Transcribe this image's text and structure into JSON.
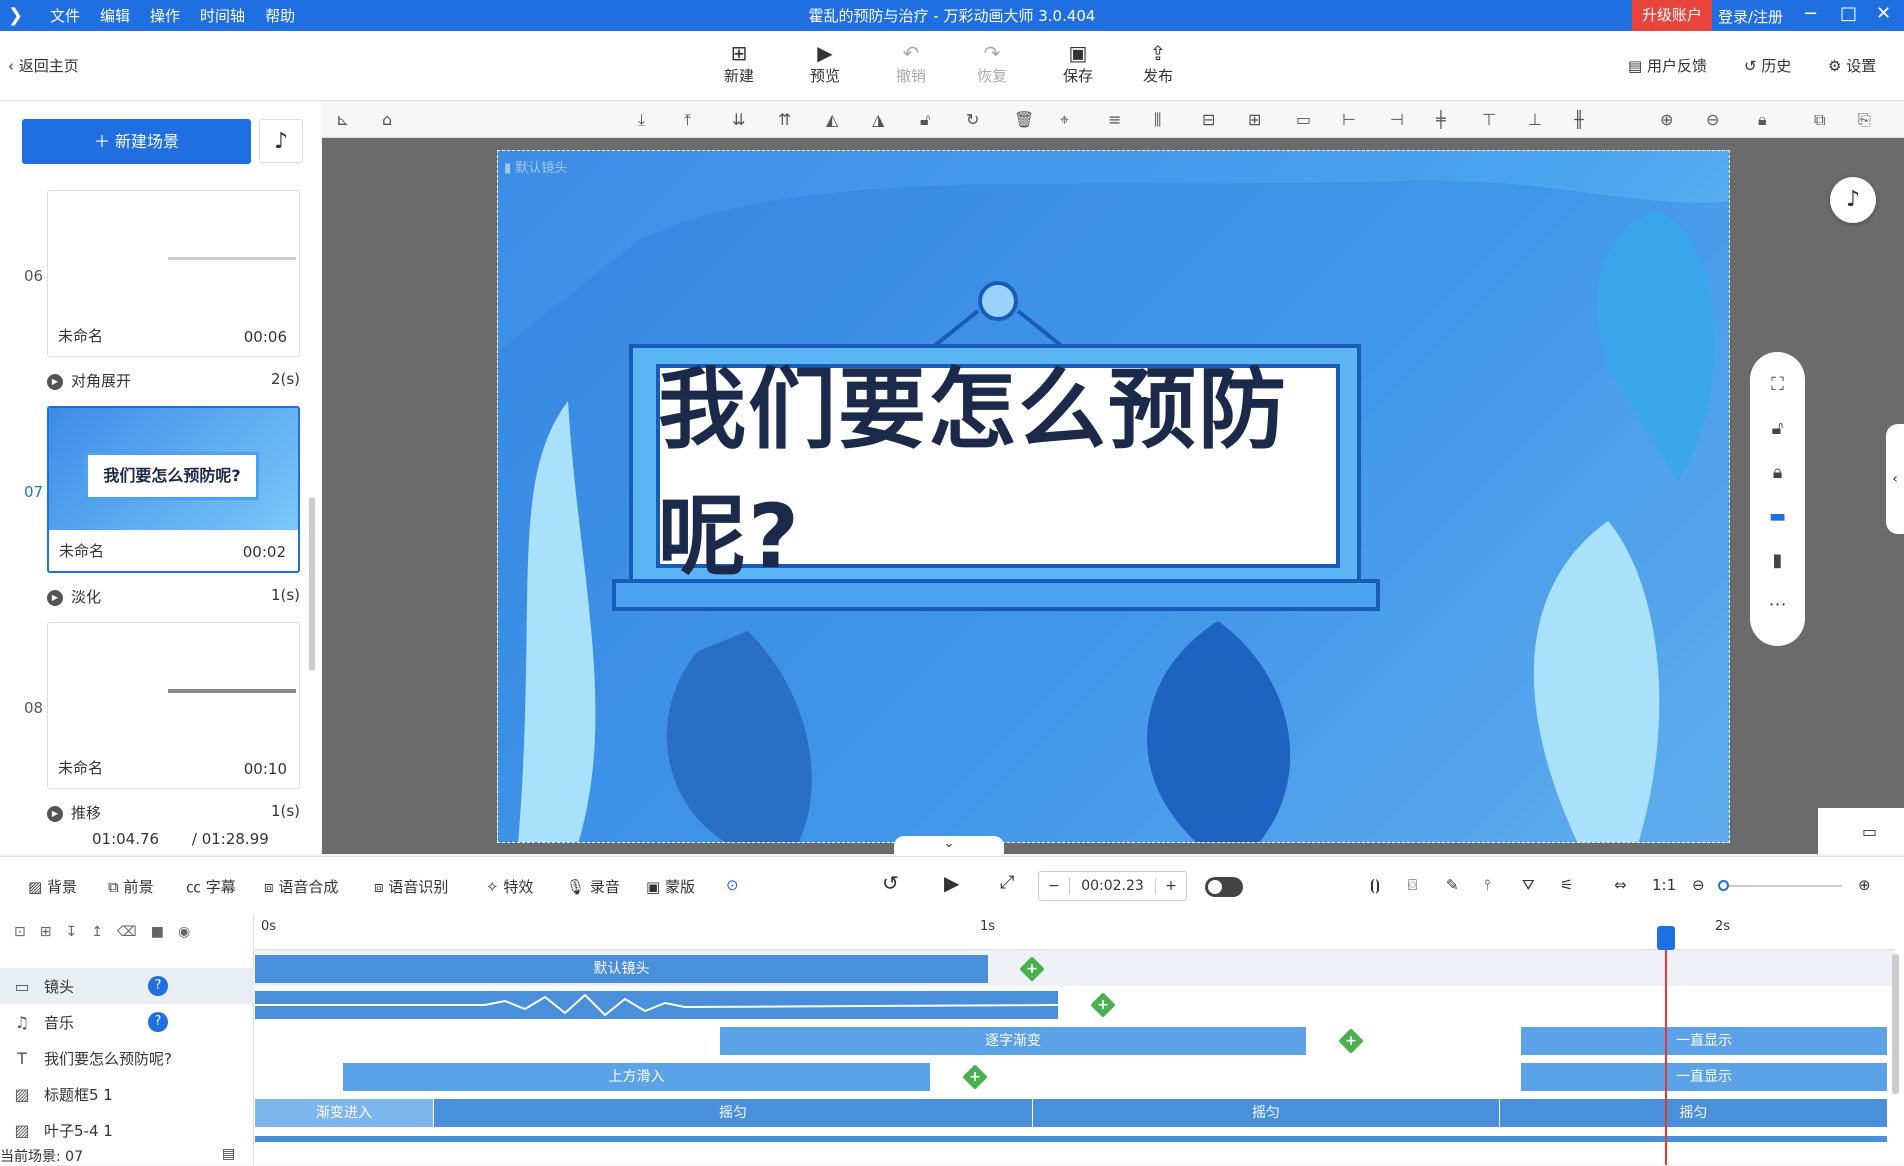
{
  "app": {
    "title": "霍乱的预防与治疗 - 万彩动画大师 3.0.404",
    "menu": [
      "文件",
      "编辑",
      "操作",
      "时间轴",
      "帮助"
    ],
    "upgrade": "升级账户",
    "login": "登录/注册"
  },
  "toolbar": {
    "back": "返回主页",
    "buttons": [
      {
        "label": "新建",
        "icon": "plus-square-icon",
        "disabled": false
      },
      {
        "label": "预览",
        "icon": "play-icon",
        "disabled": false
      },
      {
        "label": "撤销",
        "icon": "undo-icon",
        "disabled": true
      },
      {
        "label": "恢复",
        "icon": "redo-icon",
        "disabled": true
      },
      {
        "label": "保存",
        "icon": "save-icon",
        "disabled": false
      },
      {
        "label": "发布",
        "icon": "publish-icon",
        "disabled": false
      }
    ],
    "feedback": "用户反馈",
    "history": "历史",
    "settings": "设置"
  },
  "scenes_panel": {
    "new_scene": "新建场景",
    "scenes": [
      {
        "num": "06",
        "name": "未命名",
        "duration": "00:06",
        "transition": "对角展开",
        "transition_dur": "2(s)",
        "active": false
      },
      {
        "num": "07",
        "name": "未命名",
        "duration": "00:02",
        "transition": "淡化",
        "transition_dur": "1(s)",
        "active": true,
        "thumb_text": "我们要怎么预防呢?"
      },
      {
        "num": "08",
        "name": "未命名",
        "duration": "00:10",
        "transition": "推移",
        "transition_dur": "1(s)",
        "active": false
      }
    ],
    "current_time": "01:04.76",
    "total_time": "/ 01:28.99"
  },
  "stage": {
    "camera_label": "默认镜头",
    "headline": "我们要怎么预防呢?"
  },
  "bottom_bar": {
    "items": [
      "背景",
      "前景",
      "字幕",
      "语音合成",
      "语音识别",
      "特效",
      "录音",
      "蒙版"
    ],
    "time": "00:02.23"
  },
  "timeline": {
    "ruler": [
      "0s",
      "1s",
      "2s"
    ],
    "tracks": [
      {
        "name": "镜头",
        "icon": "camera-icon",
        "clips": [
          {
            "label": "默认镜头"
          }
        ]
      },
      {
        "name": "音乐",
        "icon": "music-icon",
        "clips": []
      },
      {
        "name": "我们要怎么预防呢?",
        "icon": "text-icon",
        "clips": [
          {
            "label": "逐字渐变"
          },
          {
            "label": "一直显示"
          }
        ]
      },
      {
        "name": "标题框5 1",
        "icon": "image-icon",
        "clips": [
          {
            "label": "上方滑入"
          },
          {
            "label": "一直显示"
          }
        ]
      },
      {
        "name": "叶子5-4 1",
        "icon": "image-icon",
        "clips": [
          {
            "label": "渐变进入"
          },
          {
            "label": "摇匀"
          },
          {
            "label": "摇匀"
          },
          {
            "label": "摇匀"
          }
        ]
      }
    ]
  },
  "status": "当前场景: 07",
  "colors": {
    "brand": "#1f6fe0",
    "clip": "#4a8fd9",
    "keyframe": "#4caf50",
    "playhead": "#e53935"
  }
}
